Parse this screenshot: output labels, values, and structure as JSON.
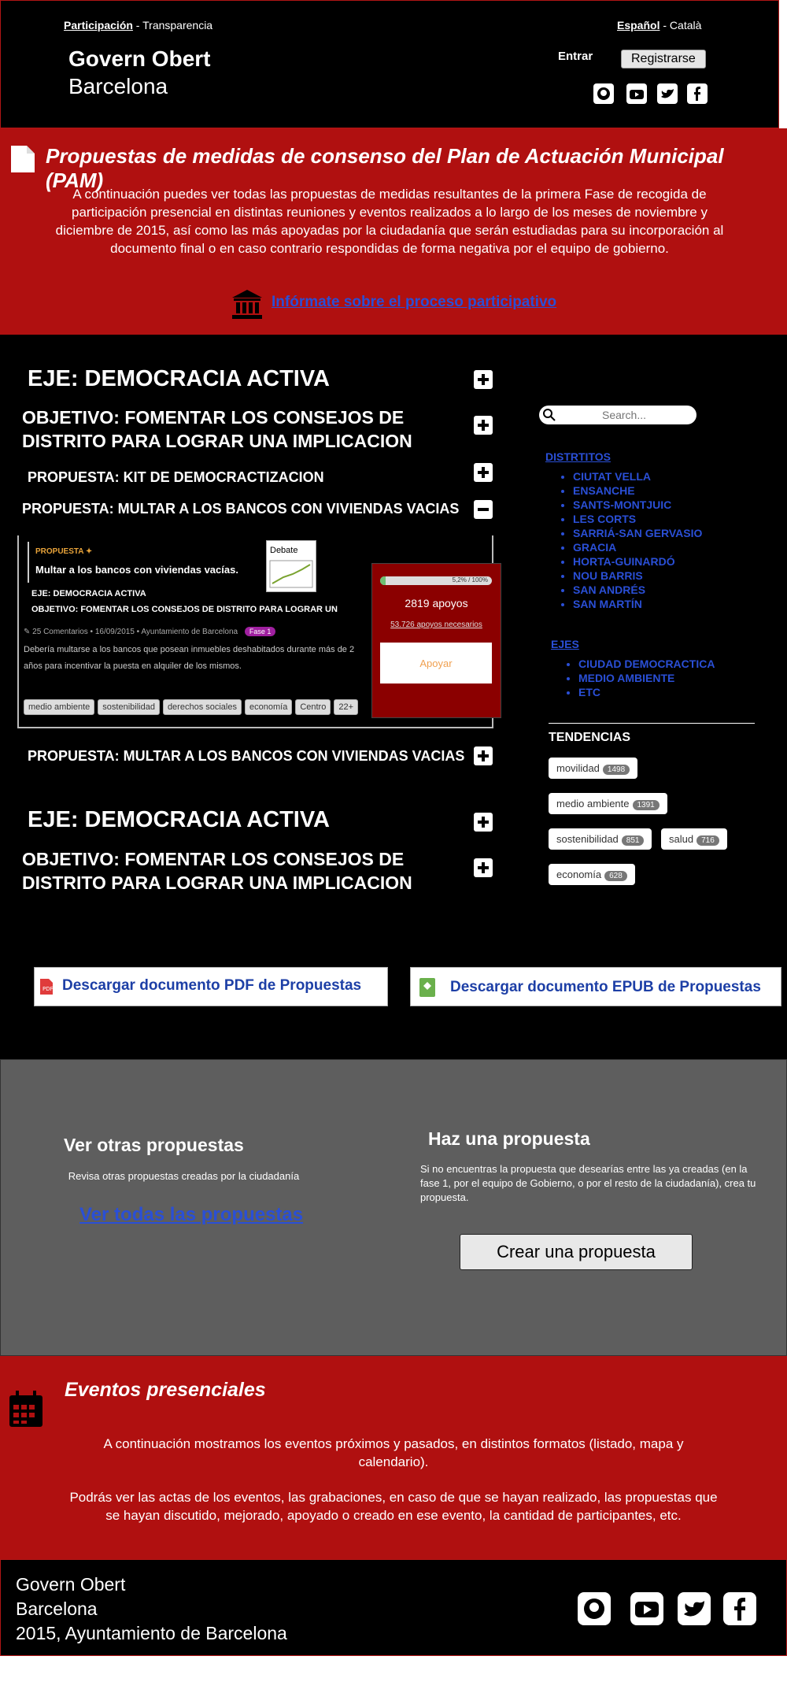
{
  "header": {
    "nav_active": "Participación",
    "nav_sep": " - ",
    "nav_other": "Transparencia",
    "lang_active": "Español",
    "lang_other": "Català",
    "brand_line1": "Govern Obert",
    "brand_line2": "Barcelona",
    "login": "Entrar",
    "register": "Registrarse",
    "social": [
      "github-icon",
      "youtube-icon",
      "twitter-icon",
      "facebook-icon"
    ]
  },
  "hero": {
    "title": "Propuestas de medidas de consenso del Plan de Actuación Municipal (PAM)",
    "description": "A continuación puedes ver todas las propuestas de medidas resultantes de la primera Fase de recogida de participación presencial en distintas reuniones y eventos realizados a lo largo de los meses de noviembre y diciembre de 2015, así como las más apoyadas por la ciudadanía que serán estudiadas para su incorporación al documento final o en caso contrario respondidas de forma negativa por el equipo de gobierno.",
    "info_link": "Infórmate sobre el proceso participativo"
  },
  "accordion": {
    "eje1": "EJE: DEMOCRACIA ACTIVA",
    "objetivo1": "OBJETIVO: FOMENTAR LOS CONSEJOS DE DISTRITO PARA LOGRAR UNA IMPLICACION",
    "propuesta1": "PROPUESTA: KIT DE DEMOCRACTIZACION",
    "propuesta2": "PROPUESTA: MULTAR A LOS BANCOS CON VIVIENDAS VACIAS",
    "propuesta3": "PROPUESTA: MULTAR A LOS BANCOS CON VIVIENDAS VACIAS",
    "eje2": "EJE: DEMOCRACIA ACTIVA",
    "objetivo2": "OBJETIVO: FOMENTAR LOS CONSEJOS DE DISTRITO PARA LOGRAR UNA IMPLICACION"
  },
  "card": {
    "kicker": "PROPUESTA",
    "title": "Multar a los bancos con viviendas vacías.",
    "debate": "Debate",
    "eje": "EJE: DEMOCRACIA ACTIVA",
    "objetivo": "OBJETIVO: FOMENTAR LOS CONSEJOS DE DISTRITO PARA LOGRAR UN IMPLICACION MAYOR",
    "comments": "25 Comentarios",
    "date": "16/09/2015",
    "author": "Ayuntamiento de Barcelona",
    "phase": "Fase 1",
    "body": "Debería multarse a los bancos que posean inmuebles deshabitados durante más de 2 años para incentivar la puesta en alquiler de los mismos.",
    "tags": [
      "medio ambiente",
      "sostenibilidad",
      "derechos sociales",
      "economía",
      "Centro",
      "22+"
    ],
    "progress_label": "5,2% / 100%",
    "progress_fraction": 0.052,
    "supports": "2819 apoyos",
    "needed": "53.726 apoyos necesarios",
    "support_button": "Apoyar"
  },
  "sidebar": {
    "search_placeholder": "Search...",
    "districts_title": "DISTRTITOS",
    "districts": [
      "CIUTAT VELLA",
      "ENSANCHE",
      "SANTS-MONTJUIC",
      "LES CORTS",
      "SARRIÁ-SAN GERVASIO",
      "GRACIA",
      "HORTA-GUINARDÓ",
      "NOU BARRIS",
      "SAN ANDRÉS",
      "SAN MARTÍN"
    ],
    "axes_title": "EJES",
    "axes": [
      "CIUDAD DEMOCRACTICA",
      "MEDIO AMBIENTE",
      "ETC"
    ],
    "trends_title": "TENDENCIAS",
    "trends": [
      {
        "label": "movilidad",
        "count": "1498"
      },
      {
        "label": "medio ambiente",
        "count": "1391"
      },
      {
        "label": "sostenibilidad",
        "count": "851"
      },
      {
        "label": "salud",
        "count": "716"
      },
      {
        "label": "economía",
        "count": "628"
      }
    ]
  },
  "downloads": {
    "pdf": "Descargar documento PDF de Propuestas",
    "epub": "Descargar documento EPUB de Propuestas"
  },
  "other": {
    "title": "Ver otras propuestas",
    "desc": "Revisa otras propuestas creadas por la ciudadanía",
    "link": "Ver todas las propuestas"
  },
  "make": {
    "title": "Haz una propuesta",
    "desc": "Si no encuentras la propuesta que desearías entre las ya creadas (en la fase 1, por el equipo de Gobierno, o por el resto de la ciudadanía), crea tu propuesta.",
    "button": "Crear una propuesta"
  },
  "events": {
    "title": "Eventos presenciales",
    "p1": "A continuación mostramos los eventos próximos y pasados, en distintos formatos (listado, mapa y calendario).",
    "p2": "Podrás ver las actas de los eventos, las grabaciones, en caso de que se hayan realizado, las propuestas que se hayan discutido, mejorado, apoyado o creado en ese evento, la cantidad de participantes, etc."
  },
  "footer": {
    "line1": "Govern Obert",
    "line2": "Barcelona",
    "line3": "2015, Ayuntamiento de Barcelona"
  }
}
